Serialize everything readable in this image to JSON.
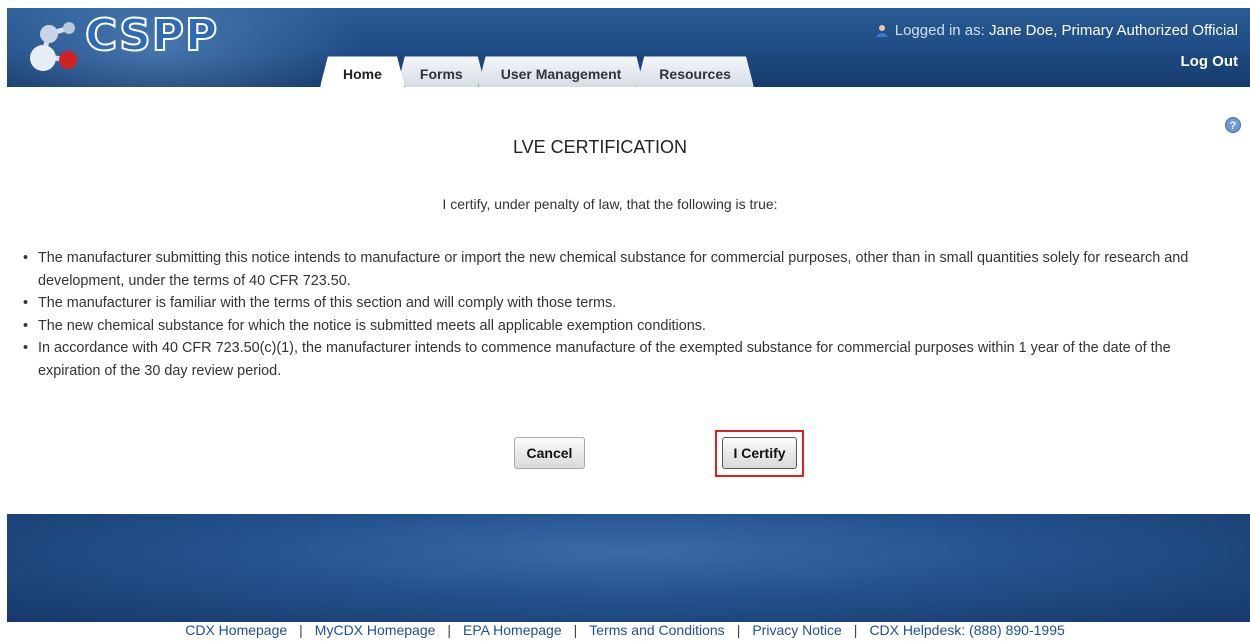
{
  "header": {
    "logo_text": "CSPP",
    "user_prefix": "Logged in as: ",
    "user_name": "Jane Doe, Primary Authorized Official",
    "logout_label": "Log Out",
    "tabs": [
      {
        "label": "Home",
        "active": true
      },
      {
        "label": "Forms",
        "active": false
      },
      {
        "label": "User Management",
        "active": false
      },
      {
        "label": "Resources",
        "active": false
      }
    ]
  },
  "main": {
    "title": "LVE CERTIFICATION",
    "intro": "I certify, under penalty of law, that the following is true:",
    "bullets": [
      "The manufacturer submitting this notice intends to manufacture or import the new chemical substance for commercial purposes, other than in small quantities solely for research and development, under the terms of 40 CFR 723.50.",
      "The manufacturer is familiar with the terms of this section and will comply with those terms.",
      "The new chemical substance for which the notice is submitted meets all applicable exemption conditions.",
      "In accordance with 40 CFR 723.50(c)(1), the manufacturer intends to commence manufacture of the exempted substance for commercial purposes within 1 year of the date of the expiration of the 30 day review period."
    ],
    "cancel_label": "Cancel",
    "certify_label": "I Certify"
  },
  "footer": {
    "links": [
      "CDX Homepage",
      "MyCDX Homepage",
      "EPA Homepage",
      "Terms and Conditions",
      "Privacy Notice",
      "CDX Helpdesk: (888) 890-1995"
    ]
  },
  "colors": {
    "header_blue": "#1d4a82",
    "highlight_red": "#e02020",
    "link_blue": "#1c4f94"
  }
}
